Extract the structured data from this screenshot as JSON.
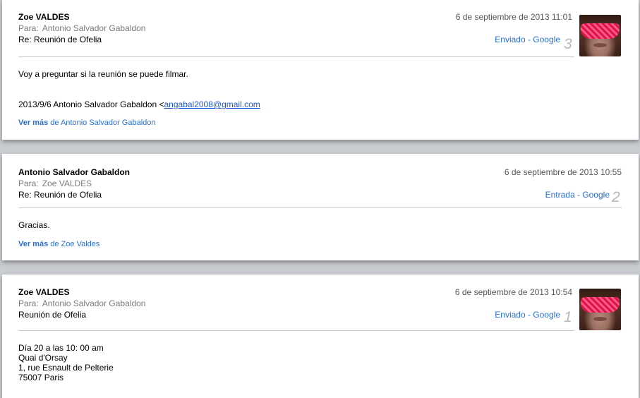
{
  "messages": [
    {
      "sender": "Zoe VALDES",
      "to_label": "Para:",
      "to": "Antonio Salvador Gabaldon",
      "subject": "Re: Reunión de Ofelia",
      "date": "6 de septiembre de 2013 11:01",
      "mailbox": "Enviado - Google",
      "number": "3",
      "body_line": "Voy a preguntar si la reunión se puede filmar.",
      "quote_prefix": "2013/9/6 Antonio Salvador Gabaldon <",
      "quote_email": "angabal2008@gmail.com",
      "more_bold": "Ver más",
      "more_rest": "de Antonio Salvador Gabaldon"
    },
    {
      "sender": "Antonio Salvador Gabaldon",
      "to_label": "Para:",
      "to": "Zoe VALDES",
      "subject": "Re: Reunión de Ofelia",
      "date": "6 de septiembre de 2013 10:55",
      "mailbox": "Entrada - Google",
      "number": "2",
      "body_line": "Gracias.",
      "more_bold": "Ver más",
      "more_rest": "de Zoe Valdes"
    },
    {
      "sender": "Zoe VALDES",
      "to_label": "Para:",
      "to": "Antonio Salvador Gabaldon",
      "subject": "Reunión de Ofelia",
      "date": "6 de septiembre de 2013 10:54",
      "mailbox": "Enviado - Google",
      "number": "1",
      "body_lines": [
        "Día 20 a las 10: 00 am",
        "Quai d'Orsay",
        "1, rue Esnault de Pelterie",
        "75007 Paris"
      ]
    }
  ]
}
